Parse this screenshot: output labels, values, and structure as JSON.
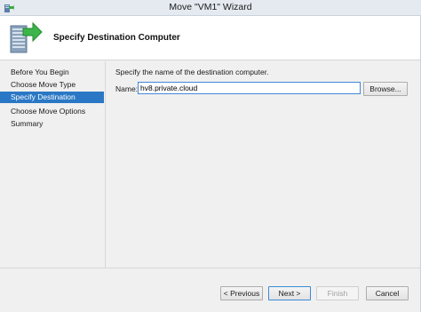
{
  "window": {
    "title": "Move \"VM1\" Wizard"
  },
  "header": {
    "title": "Specify Destination Computer"
  },
  "nav": {
    "items": [
      {
        "label": "Before You Begin"
      },
      {
        "label": "Choose Move Type"
      },
      {
        "label": "Specify Destination",
        "selected": true
      },
      {
        "label": "Choose Move Options"
      },
      {
        "label": "Summary"
      }
    ]
  },
  "content": {
    "instruction": "Specify the name of the destination computer.",
    "name_label": "Name:",
    "name_value": "hv8.private.cloud",
    "browse_label": "Browse..."
  },
  "buttons": {
    "previous": "< Previous",
    "next": "Next >",
    "finish": "Finish",
    "cancel": "Cancel"
  },
  "colors": {
    "selected_nav": "#2a78c5",
    "focus_border": "#3c8ad4"
  },
  "icons": {
    "app": "hyper-v-icon",
    "header": "server-move-arrow-icon"
  }
}
